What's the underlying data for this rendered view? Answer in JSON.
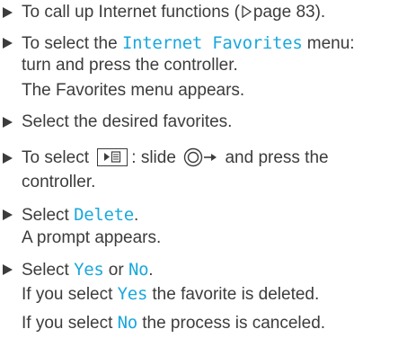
{
  "steps": [
    {
      "lines": [
        {
          "text_before": "To call up Internet functions (",
          "page_ref": "page 83",
          "text_after": ")."
        }
      ]
    },
    {
      "lines": [
        {
          "text_before": "To select the ",
          "ui_label": "Internet Favorites",
          "text_after": " menu:"
        },
        {
          "text": "turn and press the controller."
        },
        {
          "text": "The Favorites menu appears."
        }
      ]
    },
    {
      "lines": [
        {
          "text": "Select the desired favorites."
        }
      ]
    },
    {
      "lines": [
        {
          "text_before": "To select ",
          "text_mid": ": slide ",
          "text_after": " and press the"
        },
        {
          "text": "controller."
        }
      ],
      "icons": [
        "menu-button-icon",
        "controller-icon",
        "slide-right-arrow-icon"
      ]
    },
    {
      "lines": [
        {
          "text_before": "Select ",
          "ui_label": "Delete",
          "text_after": "."
        },
        {
          "text": "A prompt appears."
        }
      ]
    },
    {
      "lines": [
        {
          "text_before": "Select ",
          "ui_label": "Yes",
          "text_mid": " or ",
          "ui_label_2": "No",
          "text_after": "."
        },
        {
          "text_before": "If you select ",
          "ui_label": "Yes",
          "text_after": " the favorite is deleted."
        },
        {
          "text_before": "If you select ",
          "ui_label": "No",
          "text_after": " the process is canceled."
        }
      ]
    }
  ],
  "colors": {
    "text": "#3c3c3c",
    "ui_label": "#1aa7dc"
  }
}
